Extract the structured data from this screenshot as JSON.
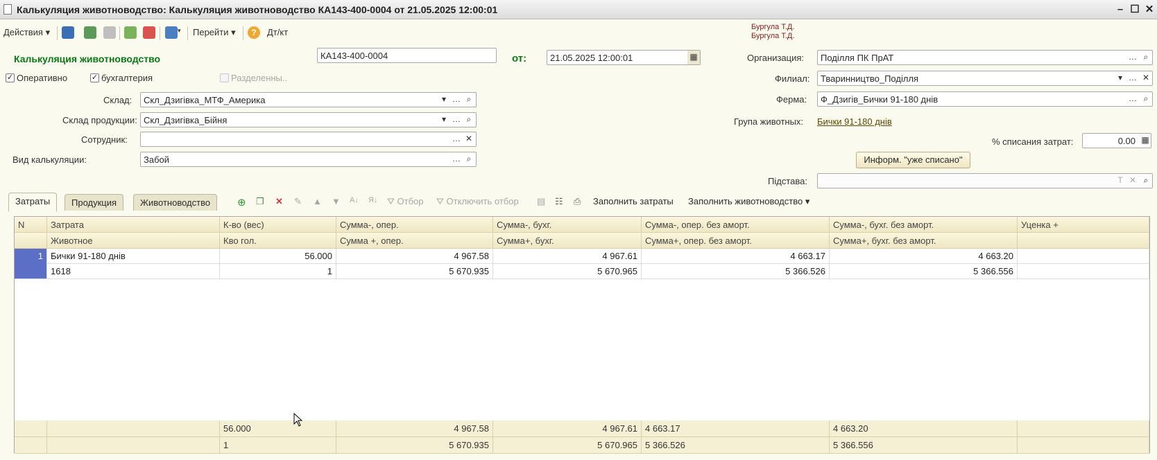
{
  "window": {
    "title": "Калькуляция животноводство: Калькуляция животноводство КА143-400-0004 от 21.05.2025 12:00:01"
  },
  "toolbar": {
    "actions": "Действия",
    "goto": "Перейти",
    "dtkt": "Дт/кт"
  },
  "user": {
    "line1": "Бургула Т.Д.",
    "line2": "Бургула Т.Д."
  },
  "header": {
    "doc_type": "Калькуляция животноводство",
    "number": "КА143-400-0004",
    "from_label": "от:",
    "date": "21.05.2025 12:00:01",
    "chk_operative": "Оперативно",
    "chk_accounting": "бухгалтерия",
    "chk_divided": "Разделенны..",
    "warehouse_label": "Склад:",
    "warehouse": "Скл_Дзигівка_МТФ_Америка",
    "product_wh_label": "Склад продукции:",
    "product_wh": "Скл_Дзигівка_Бійня",
    "employee_label": "Сотрудник:",
    "employee": "",
    "calc_type_label": "Вид калькуляции:",
    "calc_type": "Забой",
    "org_label": "Организация:",
    "org": "Поділля ПК ПрАТ",
    "branch_label": "Филиал:",
    "branch": "Тваринництво_Поділля",
    "farm_label": "Ферма:",
    "farm": "Ф_Дзигів_Бички 91-180 днів",
    "group_label": "Група животных:",
    "group": "Бички 91-180 днів",
    "writeoff_label": "% списания затрат:",
    "writeoff": "0.00",
    "info_button": "Информ. \"уже списано\"",
    "basis_label": "Підстава:",
    "basis": ""
  },
  "tabs": [
    "Затраты",
    "Продукция",
    "Животноводство"
  ],
  "tab_toolbar": {
    "filter": "Отбор",
    "unfilter": "Отключить отбор",
    "fill_costs": "Заполнить затраты",
    "fill_livestock": "Заполнить животноводство"
  },
  "table": {
    "header_top": [
      "N",
      "Затрата",
      "К-во (вес)",
      "Сумма-, опер.",
      "Сумма-, бухг.",
      "Сумма-, опер. без аморт.",
      "Сумма-, бухг. без аморт.",
      "Уценка +"
    ],
    "header_bottom": [
      "",
      "Животное",
      "Кво гол.",
      "Сумма +, опер.",
      "Сумма+, бухг.",
      "Сумма+, опер. без аморт.",
      "Сумма+, бухг. без аморт.",
      ""
    ],
    "rows": [
      {
        "n": "1",
        "top": [
          "Бички 91-180 днів",
          "56.000",
          "4 967.58",
          "4 967.61",
          "4 663.17",
          "4 663.20",
          ""
        ],
        "bottom": [
          "1618",
          "1",
          "5 670.935",
          "5 670.965",
          "5 366.526",
          "5 366.556",
          ""
        ]
      }
    ],
    "footer_top": [
      "",
      "",
      "56.000",
      "4 967.58",
      "4 967.61",
      "4 663.17",
      "4 663.20",
      ""
    ],
    "footer_bottom": [
      "",
      "",
      "1",
      "5 670.935",
      "5 670.965",
      "5 366.526",
      "5 366.556",
      ""
    ]
  }
}
